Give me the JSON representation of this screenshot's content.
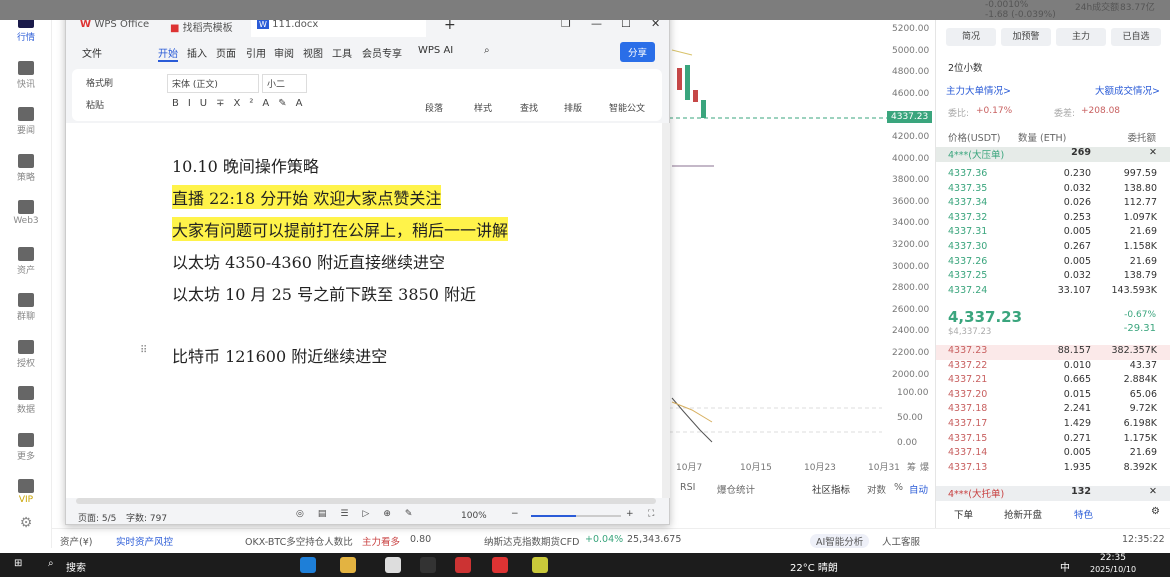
{
  "top_strip": {
    "change_pct": "-0.0010%",
    "vol_label": "24h成交额",
    "vol": "83.77亿",
    "change": "-1.68 (-0.039%)"
  },
  "sidebar": [
    {
      "label": "行情"
    },
    {
      "label": "快讯"
    },
    {
      "label": "要闻"
    },
    {
      "label": "策略"
    },
    {
      "label": "Web3"
    },
    {
      "label": "资产"
    },
    {
      "label": "群聊"
    },
    {
      "label": "授权"
    },
    {
      "label": "数据"
    },
    {
      "label": "更多"
    },
    {
      "label": "VIP"
    }
  ],
  "chart": {
    "y_ticks": [
      "5200.00",
      "5000.00",
      "4800.00",
      "4600.00",
      "4200.00",
      "4000.00",
      "3800.00",
      "3600.00",
      "3400.00",
      "3200.00",
      "3000.00",
      "2800.00",
      "2600.00",
      "2400.00",
      "2200.00",
      "2000.00"
    ],
    "rsi_ticks": [
      "100.00",
      "50.00",
      "0.00"
    ],
    "x_ticks": [
      "10月7",
      "10月15",
      "10月23",
      "10月31"
    ],
    "price_tag": "4337.23",
    "toolbar": [
      "RSI",
      "爆仓统计",
      "社区指标",
      "对数",
      "%",
      "自动"
    ],
    "corner": [
      "筹",
      "爆"
    ]
  },
  "wps": {
    "tabs": [
      "WPS Office",
      "找稻壳模板",
      "111.docx"
    ],
    "menu": [
      "文件",
      "开始",
      "插入",
      "页面",
      "引用",
      "审阅",
      "视图",
      "工具",
      "会员专享",
      "WPS AI"
    ],
    "share": "分享",
    "ribbon": {
      "format_painter": "格式刷",
      "paste": "粘贴",
      "font": "宋体 (正文)",
      "size": "小二",
      "paragraph": "段落",
      "style": "样式",
      "find": "查找",
      "layout": "排版",
      "smart": "智能公文"
    },
    "doc_lines": [
      "10.10 晚间操作策略",
      "直播 22:18 分开始   欢迎大家点赞关注",
      "大家有问题可以提前打在公屏上，稍后一一讲解",
      "以太坊 4350-4360 附近直接继续进空",
      "以太坊 10 月 25 号之前下跌至 3850 附近",
      "比特币 121600 附近继续进空"
    ],
    "status": {
      "page": "页面: 5/5",
      "words": "字数: 797",
      "zoom": "100%"
    },
    "zoom_level": 0.5
  },
  "right": {
    "buttons": [
      "简况",
      "加预警",
      "主力",
      "已自选"
    ],
    "decimals": "2位小数",
    "link1": "主力大单情况>",
    "link2": "大额成交情况>",
    "ratio_label": "委比:",
    "ratio": "+0.17%",
    "diff_label": "委差:",
    "diff": "+208.08",
    "headers": [
      "价格(USDT)",
      "数量 (ETH)",
      "委托额"
    ],
    "big_ask": {
      "label": "4***(大压单)",
      "qty": "269"
    },
    "asks": [
      [
        "4337.36",
        "0.230",
        "997.59"
      ],
      [
        "4337.35",
        "0.032",
        "138.80"
      ],
      [
        "4337.34",
        "0.026",
        "112.77"
      ],
      [
        "4337.32",
        "0.253",
        "1.097K"
      ],
      [
        "4337.31",
        "0.005",
        "21.69"
      ],
      [
        "4337.30",
        "0.267",
        "1.158K"
      ],
      [
        "4337.26",
        "0.005",
        "21.69"
      ],
      [
        "4337.25",
        "0.032",
        "138.79"
      ],
      [
        "4337.24",
        "33.107",
        "143.593K"
      ]
    ],
    "last": "4,337.23",
    "last_usd": "$4,337.23",
    "pct": "-0.67%",
    "chg": "-29.31",
    "bids": [
      [
        "4337.23",
        "88.157",
        "382.357K"
      ],
      [
        "4337.22",
        "0.010",
        "43.37"
      ],
      [
        "4337.21",
        "0.665",
        "2.884K"
      ],
      [
        "4337.20",
        "0.015",
        "65.06"
      ],
      [
        "4337.18",
        "2.241",
        "9.72K"
      ],
      [
        "4337.17",
        "1.429",
        "6.198K"
      ],
      [
        "4337.15",
        "0.271",
        "1.175K"
      ],
      [
        "4337.14",
        "0.005",
        "21.69"
      ],
      [
        "4337.13",
        "1.935",
        "8.392K"
      ]
    ],
    "big_bid": {
      "label": "4***(大托单)",
      "qty": "132"
    },
    "tabs": [
      "下单",
      "抢新开盘",
      "特色"
    ]
  },
  "bottombar": {
    "assets": "资产(¥)",
    "risk": "实时资产风控",
    "ticker": "OKX-BTC多空持仓人数比",
    "ticker_tag": "主力看多",
    "ticker_val": "0.80",
    "cfd": "纳斯达克指数期货CFD",
    "cfd_pct": "+0.04%",
    "cfd_val": "25,343.675",
    "ai": "AI智能分析",
    "service": "人工客服",
    "time": "12:35:22"
  },
  "taskbar": {
    "search": "搜索",
    "weather": "22°C 晴朗",
    "ime": "中",
    "clock": "22:35",
    "date": "2025/10/10"
  }
}
